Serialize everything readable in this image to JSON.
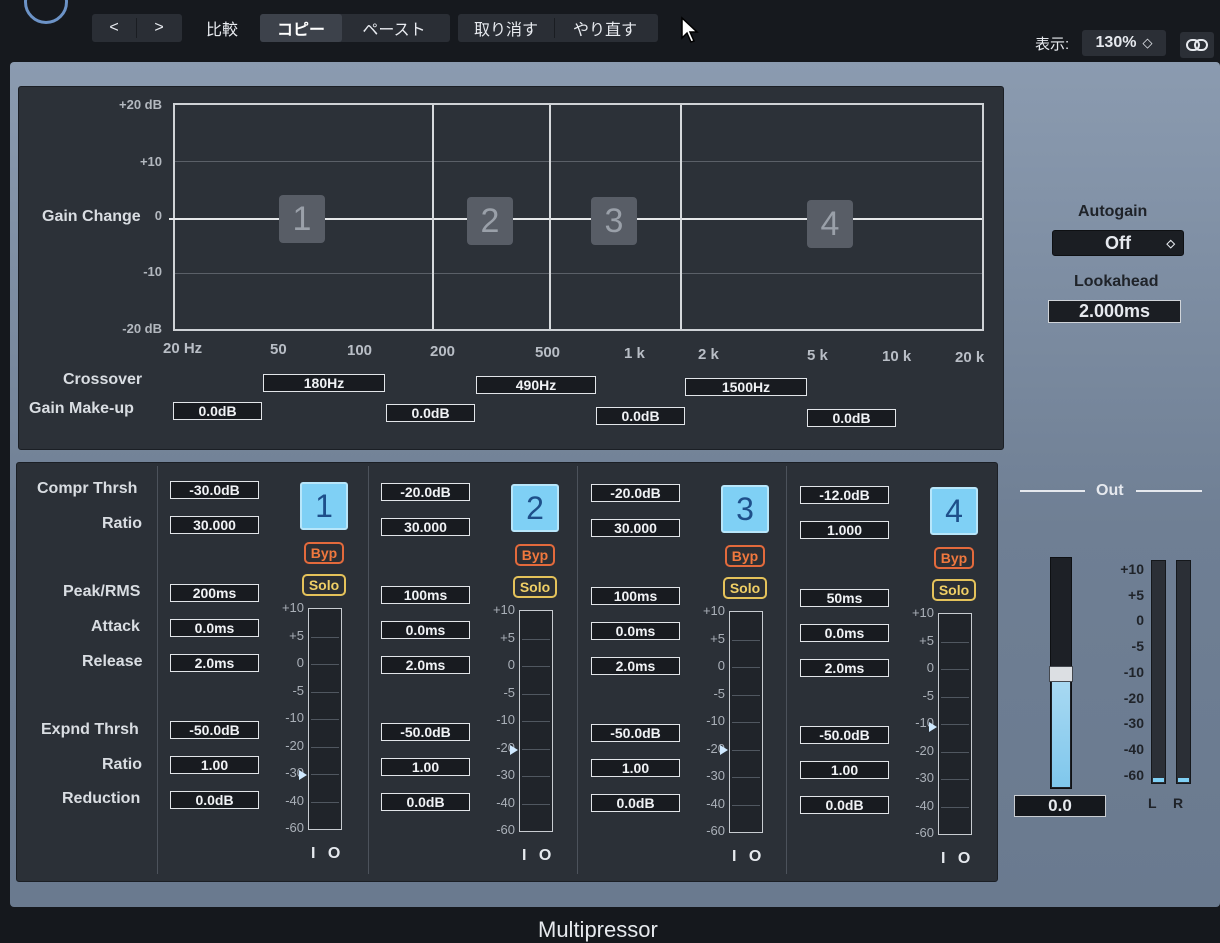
{
  "toolbar": {
    "prev_label": "<",
    "next_label": ">",
    "compare_label": "比較",
    "copy_label": "コピー",
    "paste_label": "ペースト",
    "undo_label": "取り消す",
    "redo_label": "やり直す",
    "view_label": "表示:",
    "zoom_value": "130%",
    "zoom_chevron": "◇"
  },
  "graph": {
    "y_labels": [
      "+20 dB",
      "+10",
      "0",
      "-10",
      "-20 dB"
    ],
    "y_title": "Gain Change",
    "x_labels": [
      "20 Hz",
      "50",
      "100",
      "200",
      "500",
      "1 k",
      "2 k",
      "5 k",
      "10 k",
      "20 k"
    ],
    "bands": [
      "1",
      "2",
      "3",
      "4"
    ]
  },
  "crossover": {
    "label": "Crossover",
    "values": [
      "180Hz",
      "490Hz",
      "1500Hz"
    ]
  },
  "makeup": {
    "label": "Gain Make-up",
    "values": [
      "0.0dB",
      "0.0dB",
      "0.0dB",
      "0.0dB"
    ]
  },
  "right": {
    "autogain_label": "Autogain",
    "autogain_value": "Off",
    "lookahead_label": "Lookahead",
    "lookahead_value": "2.000ms"
  },
  "param_labels": {
    "compr_thrsh": "Compr Thrsh",
    "ratio": "Ratio",
    "peak_rms": "Peak/RMS",
    "attack": "Attack",
    "release": "Release",
    "expnd_thrsh": "Expnd Thrsh",
    "exp_ratio": "Ratio",
    "reduction": "Reduction"
  },
  "band_params": [
    {
      "num": "1",
      "compr": "-30.0dB",
      "ratio": "30.000",
      "peak": "200ms",
      "attack": "0.0ms",
      "release": "2.0ms",
      "expnd": "-50.0dB",
      "exp_ratio": "1.00",
      "reduction": "0.0dB"
    },
    {
      "num": "2",
      "compr": "-20.0dB",
      "ratio": "30.000",
      "peak": "100ms",
      "attack": "0.0ms",
      "release": "2.0ms",
      "expnd": "-50.0dB",
      "exp_ratio": "1.00",
      "reduction": "0.0dB"
    },
    {
      "num": "3",
      "compr": "-20.0dB",
      "ratio": "30.000",
      "peak": "100ms",
      "attack": "0.0ms",
      "release": "2.0ms",
      "expnd": "-50.0dB",
      "exp_ratio": "1.00",
      "reduction": "0.0dB"
    },
    {
      "num": "4",
      "compr": "-12.0dB",
      "ratio": "1.000",
      "peak": "50ms",
      "attack": "0.0ms",
      "release": "2.0ms",
      "expnd": "-50.0dB",
      "exp_ratio": "1.00",
      "reduction": "0.0dB"
    }
  ],
  "band_buttons": {
    "bypass": "Byp",
    "solo": "Solo",
    "io": "I O"
  },
  "meter_scale": [
    "+10",
    "+5",
    "0",
    "-5",
    "-10",
    "-20",
    "-30",
    "-40",
    "-60"
  ],
  "output": {
    "label": "Out",
    "value": "0.0",
    "scale": [
      "+10",
      "+5",
      "0",
      "-5",
      "-10",
      "-20",
      "-30",
      "-40",
      "-60"
    ],
    "left_label": "L",
    "right_label": "R"
  },
  "plugin_title": "Multipressor",
  "colors": {
    "accent": "#7fd0f5",
    "bypass": "#f0783e",
    "solo": "#f0cf66",
    "panel": "#7d8da2"
  }
}
